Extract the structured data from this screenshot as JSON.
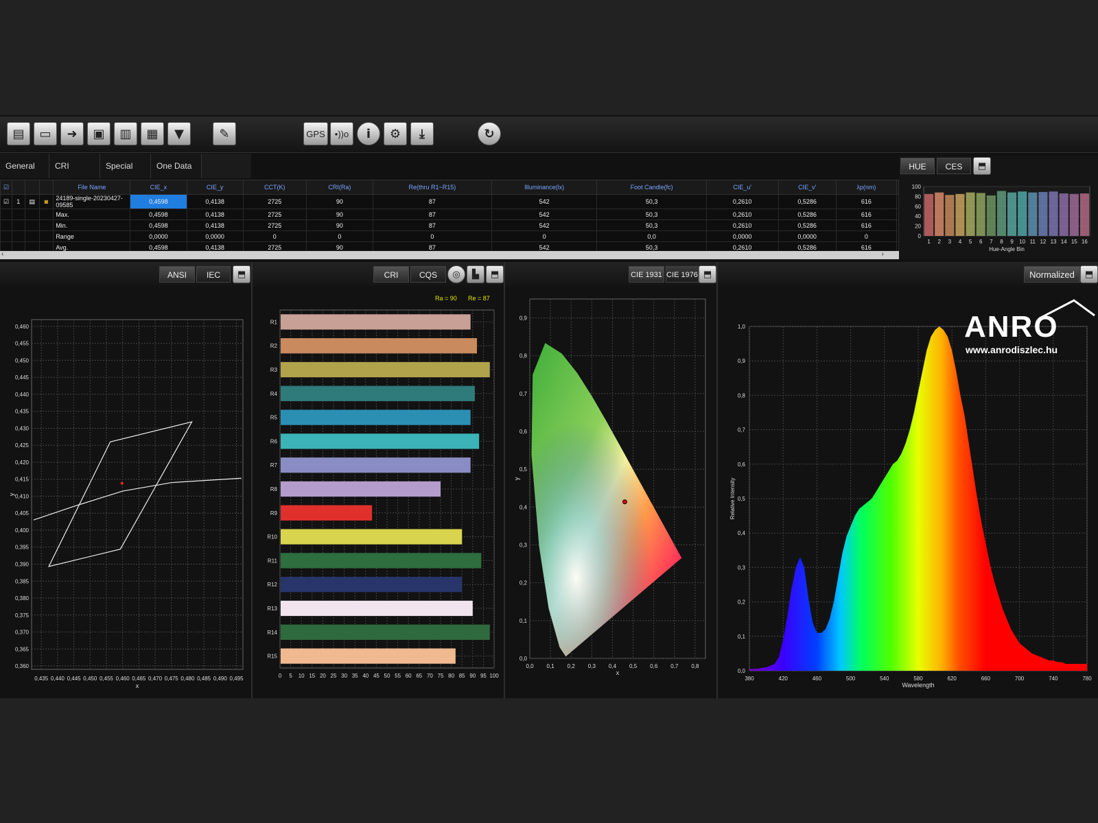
{
  "toolbar": {
    "buttons": [
      "new-file-icon",
      "open-folder-icon",
      "export-icon",
      "save-icon",
      "delete-icon",
      "print-icon",
      "filter-icon",
      "edit-icon"
    ],
    "gps_label": "GPS",
    "wireless_label": "•))o",
    "info_label": "i",
    "settings_icon": "gear-icon",
    "download_icon": "download-icon",
    "refresh_icon": "refresh-icon"
  },
  "tabs": [
    "General",
    "CRI",
    "Special",
    "One Data"
  ],
  "table": {
    "headers": [
      "File Name",
      "CIE_x",
      "CIE_y",
      "CCT(K)",
      "CRI(Ra)",
      "Re(thru R1~R15)",
      "Illuminance(lx)",
      "Foot Candle(fc)",
      "CIE_u'",
      "CIE_v'",
      "λp(nm)"
    ],
    "row_index": "1",
    "rows": [
      [
        "24189-single-20230427-09585",
        "0,4598",
        "0,4138",
        "2725",
        "90",
        "87",
        "542",
        "50,3",
        "0,2610",
        "0,5286",
        "616"
      ],
      [
        "Max.",
        "0,4598",
        "0,4138",
        "2725",
        "90",
        "87",
        "542",
        "50,3",
        "0,2610",
        "0,5286",
        "616"
      ],
      [
        "Min.",
        "0,4598",
        "0,4138",
        "2725",
        "90",
        "87",
        "542",
        "50,3",
        "0,2610",
        "0,5286",
        "616"
      ],
      [
        "Range",
        "0,0000",
        "0,0000",
        "0",
        "0",
        "0",
        "0",
        "0,0",
        "0,0000",
        "0,0000",
        "0"
      ],
      [
        "Avg.",
        "0,4598",
        "0,4138",
        "2725",
        "90",
        "87",
        "542",
        "50,3",
        "0,2610",
        "0,5286",
        "616"
      ]
    ]
  },
  "hue_panel": {
    "tab_hue": "HUE",
    "tab_ces": "CES"
  },
  "panels": {
    "ansi": {
      "btn_ansi": "ANSI",
      "btn_iec": "IEC"
    },
    "cri": {
      "btn_cri": "CRI",
      "btn_cqs": "CQS",
      "summary_ra": "Ra = 90",
      "summary_re": "Re = 87"
    },
    "cie": {
      "btn_1931": "CIE 1931",
      "btn_1976": "CIE 1976"
    },
    "spectrum": {
      "btn_normalized": "Normalized"
    }
  },
  "logo": {
    "brand": "ANRO",
    "url": "www.anrodiszlec.hu"
  },
  "chart_data": [
    {
      "type": "bar",
      "name_id": "hue-angle",
      "categories": [
        "1",
        "2",
        "3",
        "4",
        "5",
        "6",
        "7",
        "8",
        "9",
        "10",
        "11",
        "12",
        "13",
        "14",
        "15",
        "16"
      ],
      "values": [
        85,
        88,
        83,
        85,
        88,
        87,
        82,
        91,
        88,
        90,
        88,
        89,
        90,
        86,
        85,
        86
      ],
      "colors": [
        "#c76565",
        "#d98a6a",
        "#c7895a",
        "#c9a35e",
        "#a8ad5f",
        "#8fa55f",
        "#6d9462",
        "#5f9a7d",
        "#57a6a0",
        "#4fa6a8",
        "#5e8fb0",
        "#6b7fb5",
        "#7c74b1",
        "#8c6ca7",
        "#9e6a98",
        "#b06a84"
      ],
      "xlabel": "Hue-Angle Bin",
      "ylim": [
        0,
        100
      ],
      "yticks": [
        "0",
        "20",
        "40",
        "60",
        "80",
        "100"
      ]
    },
    {
      "type": "scatter",
      "name_id": "ansi-chromaticity",
      "xlabel": "x",
      "ylabel": "y",
      "xlim": [
        0.432,
        0.497
      ],
      "ylim": [
        0.359,
        0.462
      ],
      "xticks": [
        "0,435",
        "0,440",
        "0,445",
        "0,450",
        "0,455",
        "0,460",
        "0,465",
        "0,470",
        "0,475",
        "0,480",
        "0,485",
        "0,490",
        "0,495"
      ],
      "yticks": [
        "0,360",
        "0,365",
        "0,370",
        "0,375",
        "0,380",
        "0,385",
        "0,390",
        "0,395",
        "0,400",
        "0,405",
        "0,410",
        "0,415",
        "0,420",
        "0,425",
        "0,430",
        "0,435",
        "0,440",
        "0,445",
        "0,450",
        "0,455",
        "0,460"
      ],
      "quadrangle": [
        [
          0.4373,
          0.3893
        ],
        [
          0.4562,
          0.426
        ],
        [
          0.4813,
          0.4319
        ],
        [
          0.4593,
          0.3944
        ]
      ],
      "planckian": [
        [
          0.4326,
          0.403
        ],
        [
          0.445,
          0.407
        ],
        [
          0.46,
          0.4115
        ],
        [
          0.475,
          0.414
        ],
        [
          0.4965,
          0.4153
        ]
      ],
      "point": [
        0.4598,
        0.4138
      ]
    },
    {
      "type": "bar",
      "name_id": "cri-bars",
      "orientation": "horizontal",
      "categories": [
        "R1",
        "R2",
        "R3",
        "R4",
        "R5",
        "R6",
        "R7",
        "R8",
        "R9",
        "R10",
        "R11",
        "R12",
        "R13",
        "R14",
        "R15"
      ],
      "values": [
        89,
        92,
        98,
        91,
        89,
        93,
        89,
        75,
        43,
        85,
        94,
        85,
        90,
        98,
        82
      ],
      "colors": [
        "#c9a096",
        "#c98a5e",
        "#b1a34b",
        "#2f7b7b",
        "#2b8fb3",
        "#3bb3b7",
        "#8a8cc4",
        "#b49ccc",
        "#e0302b",
        "#d9d44e",
        "#2e6e3f",
        "#27356b",
        "#f2e4ef",
        "#2f6a3e",
        "#f0b98f"
      ],
      "xlim": [
        0,
        100
      ],
      "xticks": [
        "0",
        "5",
        "10",
        "15",
        "20",
        "25",
        "30",
        "35",
        "40",
        "45",
        "50",
        "55",
        "60",
        "65",
        "70",
        "75",
        "80",
        "85",
        "90",
        "95",
        "100"
      ]
    },
    {
      "type": "scatter",
      "name_id": "cie-1931",
      "xlabel": "x",
      "ylabel": "y",
      "xlim": [
        0,
        0.85
      ],
      "ylim": [
        0,
        0.95
      ],
      "xticks": [
        "0,0",
        "0,1",
        "0,2",
        "0,3",
        "0,4",
        "0,5",
        "0,6",
        "0,7",
        "0,8"
      ],
      "yticks": [
        "0,0",
        "0,1",
        "0,2",
        "0,3",
        "0,4",
        "0,5",
        "0,6",
        "0,7",
        "0,8",
        "0,9"
      ],
      "point": [
        0.4598,
        0.4138
      ]
    },
    {
      "type": "area",
      "name_id": "spectrum",
      "xlabel": "Wavelength",
      "ylabel": "Relative Intensity",
      "xlim": [
        380,
        780
      ],
      "ylim": [
        0,
        1.0
      ],
      "xticks": [
        "380",
        "420",
        "460",
        "500",
        "540",
        "580",
        "620",
        "660",
        "700",
        "740",
        "780"
      ],
      "yticks": [
        "0,0",
        "0,1",
        "0,2",
        "0,3",
        "0,4",
        "0,5",
        "0,6",
        "0,7",
        "0,8",
        "0,9",
        "1,0"
      ],
      "x": [
        380,
        390,
        400,
        410,
        415,
        420,
        425,
        430,
        435,
        440,
        445,
        450,
        455,
        460,
        465,
        470,
        475,
        480,
        485,
        490,
        495,
        500,
        505,
        510,
        515,
        520,
        525,
        530,
        535,
        540,
        545,
        550,
        555,
        560,
        565,
        570,
        575,
        580,
        585,
        590,
        595,
        600,
        605,
        610,
        615,
        620,
        625,
        630,
        635,
        640,
        645,
        650,
        655,
        660,
        665,
        670,
        675,
        680,
        685,
        690,
        695,
        700,
        705,
        710,
        715,
        720,
        725,
        730,
        735,
        740,
        745,
        750,
        755,
        760,
        765,
        770,
        775,
        780
      ],
      "values": [
        0.005,
        0.006,
        0.01,
        0.02,
        0.04,
        0.09,
        0.16,
        0.24,
        0.3,
        0.33,
        0.3,
        0.21,
        0.14,
        0.11,
        0.11,
        0.12,
        0.15,
        0.2,
        0.27,
        0.34,
        0.39,
        0.42,
        0.45,
        0.47,
        0.48,
        0.49,
        0.5,
        0.52,
        0.54,
        0.56,
        0.58,
        0.6,
        0.61,
        0.63,
        0.66,
        0.7,
        0.75,
        0.81,
        0.87,
        0.93,
        0.97,
        0.99,
        1.0,
        0.99,
        0.97,
        0.93,
        0.87,
        0.8,
        0.74,
        0.66,
        0.58,
        0.5,
        0.43,
        0.37,
        0.31,
        0.26,
        0.22,
        0.18,
        0.15,
        0.12,
        0.1,
        0.08,
        0.07,
        0.06,
        0.05,
        0.045,
        0.04,
        0.035,
        0.03,
        0.03,
        0.025,
        0.025,
        0.02,
        0.02,
        0.02,
        0.02,
        0.02,
        0.02
      ]
    }
  ]
}
